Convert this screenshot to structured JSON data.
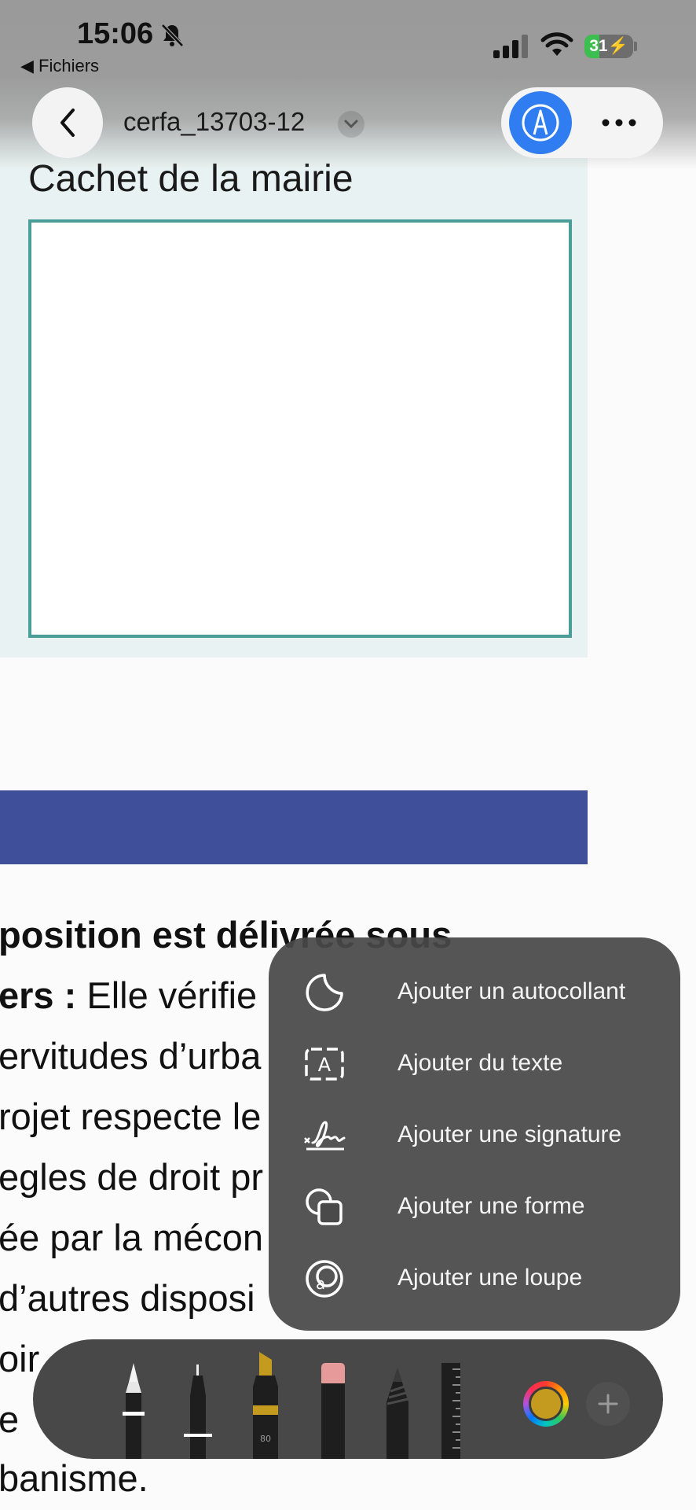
{
  "status_bar": {
    "time": "15:06",
    "back_app": "◀ Fichiers",
    "battery": "31",
    "battery_level_percent": 31,
    "icons": [
      "bell-slash-icon",
      "signal-icon",
      "wifi-icon",
      "battery-charging-icon"
    ]
  },
  "nav": {
    "document_title": "cerfa_13703-12",
    "icons": [
      "chevron-left-icon",
      "chevron-down-icon",
      "markup-pen-icon",
      "ellipsis-icon"
    ]
  },
  "document": {
    "stamp_label": "Cachet de la mairie",
    "lines": [
      {
        "bold": "position est délivrée sous",
        "text": ""
      },
      {
        "bold": "ers : ",
        "text": "Elle vérifie"
      },
      {
        "bold": "",
        "text": "ervitudes d’urba"
      },
      {
        "bold": "",
        "text": "rojet respecte le"
      },
      {
        "bold": "",
        "text": "egles de droit pr"
      },
      {
        "bold": "",
        "text": "ée par la mécon"
      },
      {
        "bold": "",
        "text": "d’autres disposi"
      },
      {
        "bold": "",
        "text": "oir"
      },
      {
        "bold": "",
        "text": "e"
      }
    ],
    "last_line": "banisme.",
    "band_color": "#3f4f9a"
  },
  "menu": {
    "items": [
      {
        "label": "Ajouter un autocollant",
        "icon": "sticker-icon"
      },
      {
        "label": "Ajouter du texte",
        "icon": "text-box-icon"
      },
      {
        "label": "Ajouter une signature",
        "icon": "signature-icon"
      },
      {
        "label": "Ajouter une forme",
        "icon": "shape-icon"
      },
      {
        "label": "Ajouter une loupe",
        "icon": "magnifier-icon"
      }
    ]
  },
  "palette": {
    "marker_label": "80",
    "tools": [
      "pen-tool",
      "fineliner-tool",
      "highlighter-tool",
      "eraser-tool",
      "pencil-tool",
      "ruler-tool"
    ],
    "selected_color": "#c49a1f"
  }
}
